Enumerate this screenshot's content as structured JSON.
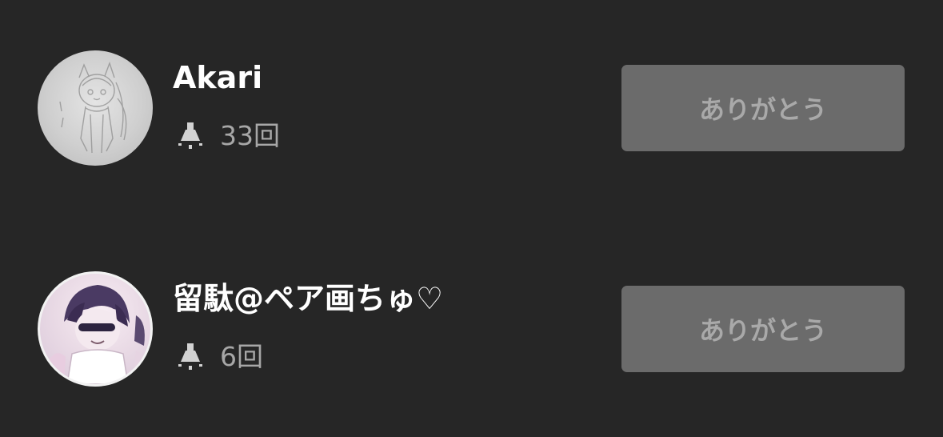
{
  "supporters": [
    {
      "name": "Akari",
      "count": "33回",
      "button_label": "ありがとう"
    },
    {
      "name": "留駄@ペア画ちゅ♡",
      "count": "6回",
      "button_label": "ありがとう"
    }
  ],
  "icons": {
    "count_icon": "lamp-icon"
  },
  "colors": {
    "background": "#262626",
    "name_text": "#ffffff",
    "count_text": "#a7a7a7",
    "button_bg": "#6b6b6b",
    "button_text": "#a9a9a9"
  }
}
